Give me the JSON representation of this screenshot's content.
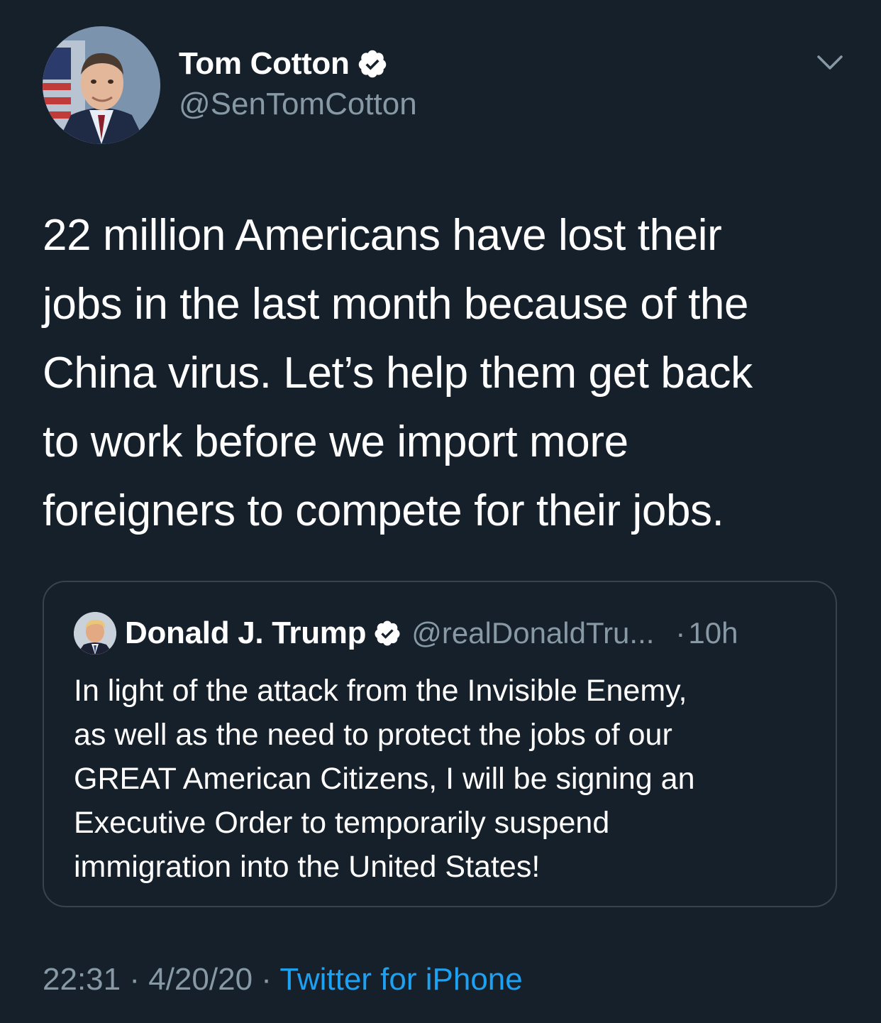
{
  "tweet": {
    "author": {
      "display_name": "Tom Cotton",
      "handle": "@SenTomCotton",
      "verified": true,
      "avatar": "senator-portrait-avatar"
    },
    "menu_icon": "chevron-down-icon",
    "text_lines": [
      "22 million Americans have lost their",
      "jobs in the last month because of the",
      "China virus. Let’s help them get back",
      "to work before we import more",
      "foreigners to compete for their jobs."
    ],
    "quoted_tweet": {
      "display_name": "Donald J. Trump",
      "handle": "@realDonaldTru...",
      "separator": "·",
      "time": "10h",
      "verified": true,
      "avatar": "president-portrait-avatar",
      "text_lines": [
        "In light of the attack from the Invisible Enemy,",
        "as well as the need to protect the jobs of our",
        "GREAT American Citizens, I will be signing an",
        "Executive Order to temporarily suspend",
        "immigration into the United States!"
      ]
    },
    "meta": {
      "time": "22:31",
      "separator": "·",
      "date": "4/20/20",
      "source": "Twitter for iPhone"
    }
  },
  "colors": {
    "background": "#15202b",
    "text_primary": "#ffffff",
    "text_secondary": "#8899a6",
    "accent": "#1da1f2",
    "border": "#38444d"
  }
}
